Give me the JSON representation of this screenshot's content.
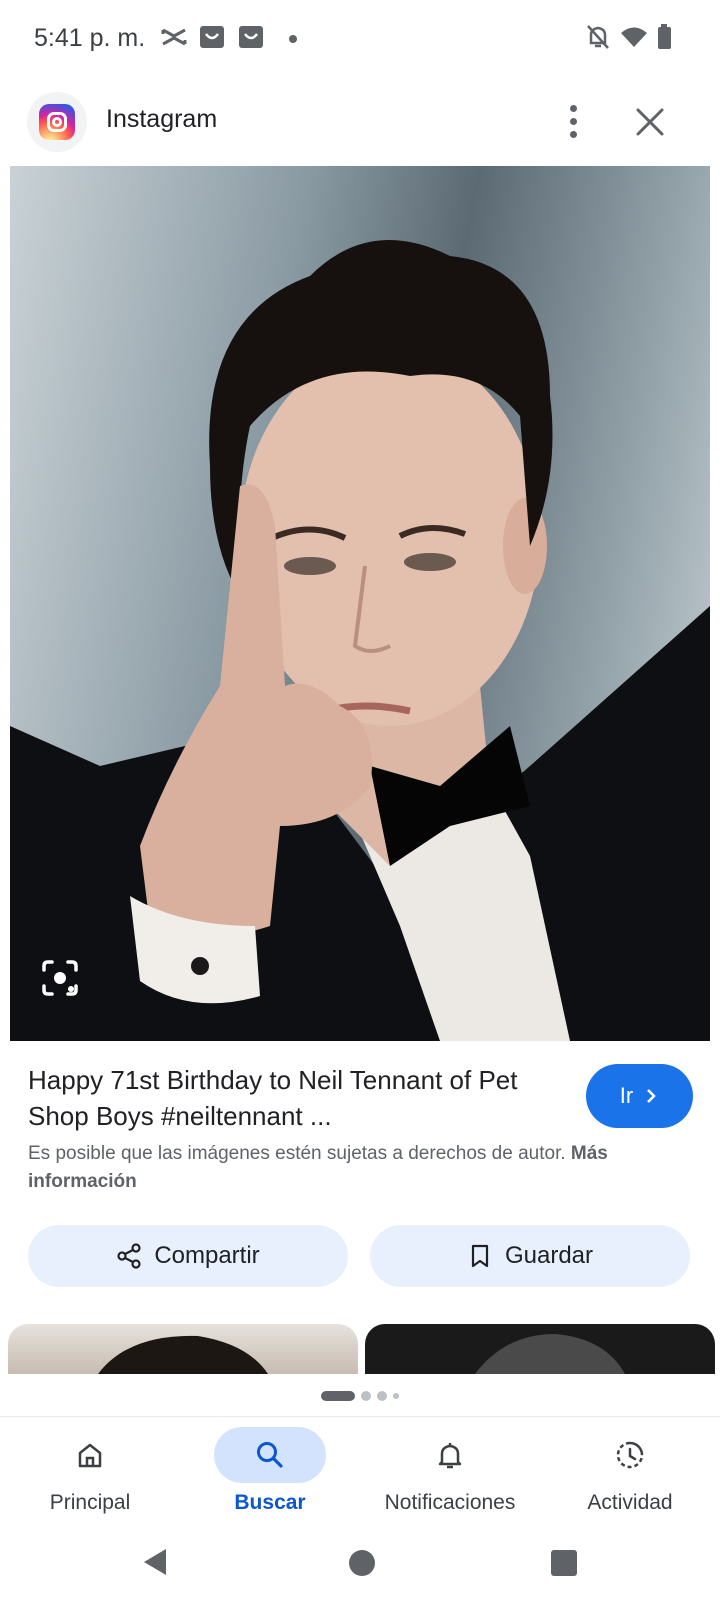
{
  "status_bar": {
    "time": "5:41 p. m."
  },
  "header": {
    "title": "Instagram"
  },
  "image": {
    "alt": "Neil Tennant"
  },
  "result": {
    "title": "Happy 71st Birthday to Neil Tennant of Pet Shop Boys #neiltennant ...",
    "go_label": "Ir",
    "copyright_text": "Es posible que las imágenes estén sujetas a derechos de autor.",
    "more_info_label": "Más información"
  },
  "actions": {
    "share_label": "Compartir",
    "save_label": "Guardar"
  },
  "bottom_nav": {
    "items": [
      {
        "label": "Principal",
        "icon": "home-icon"
      },
      {
        "label": "Buscar",
        "icon": "search-icon"
      },
      {
        "label": "Notificaciones",
        "icon": "bell-icon"
      },
      {
        "label": "Actividad",
        "icon": "history-icon"
      }
    ],
    "active_index": 1
  },
  "colors": {
    "accent": "#1a73e8",
    "active_nav": "#0b57d0",
    "chip_bg": "#e8f0fe"
  }
}
